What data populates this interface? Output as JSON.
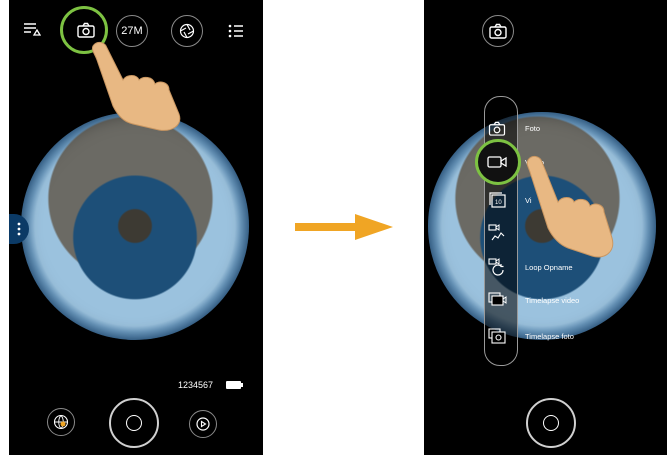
{
  "left_screen": {
    "resolution_label": "27M",
    "counter_text": "1234567"
  },
  "right_screen": {
    "modes": [
      {
        "label": "Foto",
        "icon": "photo-icon"
      },
      {
        "label": "Video",
        "icon": "video-icon"
      },
      {
        "label": "Vi",
        "icon": "burst-photo-icon"
      },
      {
        "label": "",
        "icon": "slow-motion-icon"
      },
      {
        "label": "Loop Opname",
        "icon": "loop-recording-icon"
      },
      {
        "label": "Timelapse video",
        "icon": "timelapse-video-icon"
      },
      {
        "label": "Timelapse foto",
        "icon": "timelapse-photo-icon"
      }
    ]
  },
  "colors": {
    "highlight_ring": "#7dc242",
    "arrow": "#f0a524",
    "phone_bg": "#000000",
    "hand": "#e8b883"
  }
}
